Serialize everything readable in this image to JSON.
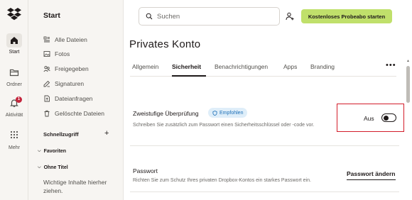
{
  "rail": {
    "items": [
      {
        "label": "Start",
        "icon": "home-icon"
      },
      {
        "label": "Ordner",
        "icon": "folder-icon"
      },
      {
        "label": "Aktivität",
        "icon": "bell-icon",
        "badge": "1"
      },
      {
        "label": "Mehr",
        "icon": "grid-icon"
      }
    ]
  },
  "sidebar": {
    "title": "Start",
    "items": [
      {
        "label": "Alle Dateien",
        "icon": "files-icon"
      },
      {
        "label": "Fotos",
        "icon": "photos-icon"
      },
      {
        "label": "Freigegeben",
        "icon": "shared-icon"
      },
      {
        "label": "Signaturen",
        "icon": "signature-icon"
      },
      {
        "label": "Dateianfragen",
        "icon": "file-request-icon"
      },
      {
        "label": "Gelöschte Dateien",
        "icon": "trash-icon"
      }
    ],
    "quick_access": "Schnellzugriff",
    "favorites": "Favoriten",
    "untitled": "Ohne Titel",
    "hint": "Wichtige Inhalte hierher ziehen."
  },
  "topbar": {
    "search_placeholder": "Suchen",
    "cta_label": "Kostenloses Probeabo starten"
  },
  "main": {
    "title": "Privates Konto",
    "tabs": [
      "Allgemein",
      "Sicherheit",
      "Benachrichtigungen",
      "Apps",
      "Branding"
    ],
    "active_tab": "Sicherheit",
    "more_label": "•••",
    "two_step": {
      "title": "Zweistufige Überprüfung",
      "badge": "Empfohlen",
      "description": "Schreiben Sie zusätzlich zum Passwort einen Sicherheitsschlüssel oder -code vor.",
      "toggle_label": "Aus",
      "toggle_on": false
    },
    "password": {
      "title": "Passwort",
      "description": "Richten Sie zum Schutz Ihres privaten Dropbox-Kontos ein starkes Passwort ein.",
      "button_label": "Passwort ändern"
    }
  },
  "colors": {
    "accent_green": "#c0e06b",
    "highlight_red": "#d31d2a",
    "badge_blue": "#1d6fb8",
    "notification_red": "#c4253c"
  }
}
